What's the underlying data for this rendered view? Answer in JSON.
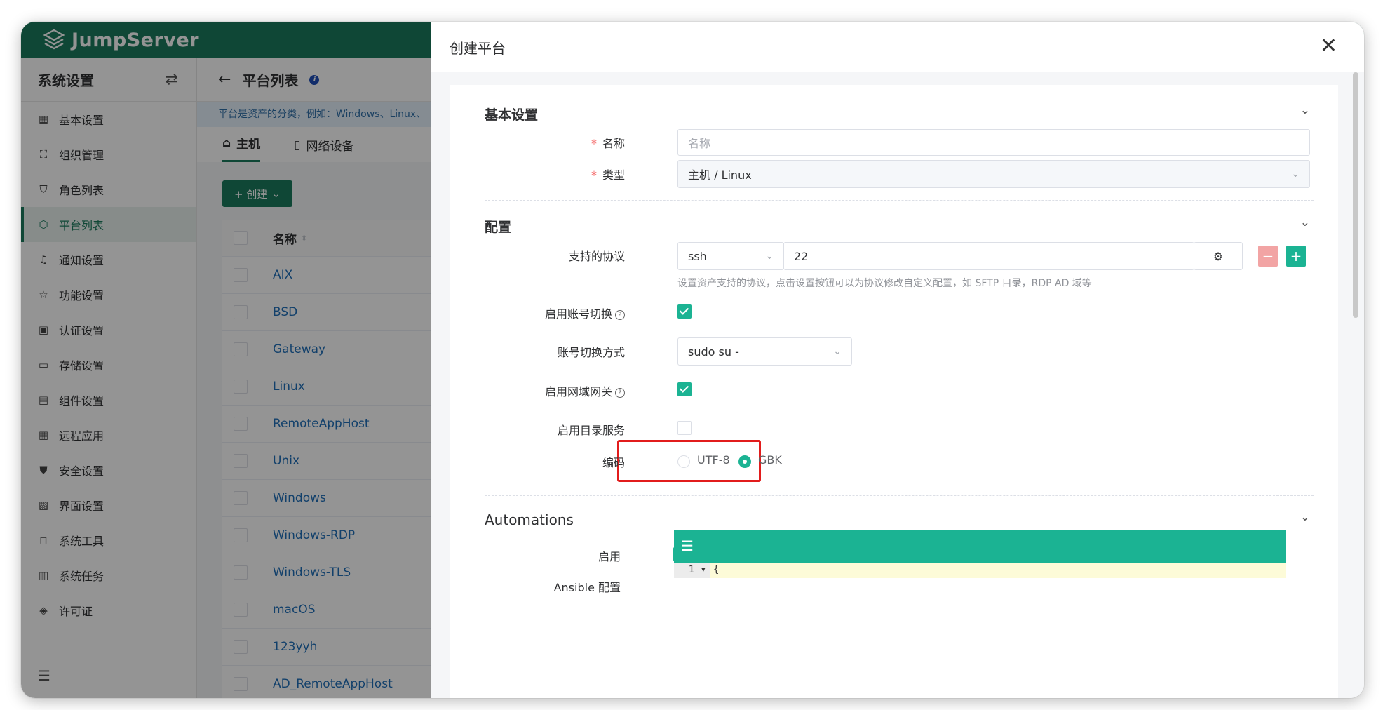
{
  "app": {
    "logo_text": "JumpServer",
    "brand_color": "#1a7a5e"
  },
  "sidebar": {
    "title": "系统设置",
    "items": [
      {
        "label": "基本设置",
        "icon": "grid-icon"
      },
      {
        "label": "组织管理",
        "icon": "org-tree-icon"
      },
      {
        "label": "角色列表",
        "icon": "shirt-icon"
      },
      {
        "label": "平台列表",
        "icon": "cube-icon",
        "active": true
      },
      {
        "label": "通知设置",
        "icon": "bell-icon"
      },
      {
        "label": "功能设置",
        "icon": "star-icon"
      },
      {
        "label": "认证设置",
        "icon": "id-card-icon"
      },
      {
        "label": "存储设置",
        "icon": "inbox-icon"
      },
      {
        "label": "组件设置",
        "icon": "monitor-icon"
      },
      {
        "label": "远程应用",
        "icon": "apps-icon"
      },
      {
        "label": "安全设置",
        "icon": "shield-icon"
      },
      {
        "label": "界面设置",
        "icon": "layout-icon"
      },
      {
        "label": "系统工具",
        "icon": "toolbox-icon"
      },
      {
        "label": "系统任务",
        "icon": "task-icon"
      },
      {
        "label": "许可证",
        "icon": "badge-icon"
      }
    ]
  },
  "page": {
    "title": "平台列表",
    "tip": "平台是资产的分类，例如：Windows、Linux、",
    "tabs": [
      {
        "label": "主机",
        "active": true
      },
      {
        "label": "网络设备"
      }
    ],
    "create_label": "+ 创建",
    "table": {
      "header": "名称",
      "rows": [
        "AIX",
        "BSD",
        "Gateway",
        "Linux",
        "RemoteAppHost",
        "Unix",
        "Windows",
        "Windows-RDP",
        "Windows-TLS",
        "macOS",
        "123yyh",
        "AD_RemoteAppHost"
      ]
    }
  },
  "drawer": {
    "title": "创建平台",
    "basic": {
      "section_title": "基本设置",
      "name_label": "名称",
      "name_placeholder": "名称",
      "type_label": "类型",
      "type_value": "主机 / Linux"
    },
    "config": {
      "section_title": "配置",
      "protocol_label": "支持的协议",
      "protocol_name": "ssh",
      "protocol_port": "22",
      "protocol_hint": "设置资产支持的协议，点击设置按钮可以为协议修改自定义配置，如 SFTP 目录，RDP AD 域等",
      "su_enabled_label": "启用账号切换",
      "su_enabled": true,
      "su_method_label": "账号切换方式",
      "su_method_value": "sudo su -",
      "domain_enabled_label": "启用网域网关",
      "domain_enabled": true,
      "ds_enabled_label": "启用目录服务",
      "ds_enabled": false,
      "charset_label": "编码",
      "charset_options": [
        "UTF-8",
        "GBK"
      ],
      "charset_selected": "GBK"
    },
    "automations": {
      "section_title": "Automations",
      "enabled_label": "启用",
      "enabled": true,
      "ansible_label": "Ansible 配置",
      "code_line_number": "1",
      "code_first_line": "{"
    }
  }
}
